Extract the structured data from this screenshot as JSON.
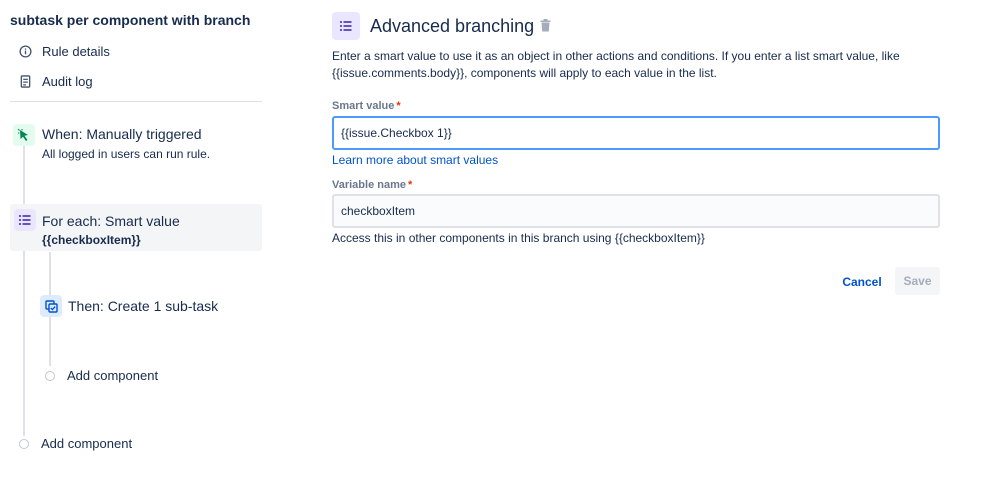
{
  "rule": {
    "title": "subtask per component with branch",
    "nav": [
      {
        "label": "Rule details",
        "icon": "info-icon"
      },
      {
        "label": "Audit log",
        "icon": "document-icon"
      }
    ]
  },
  "flow": {
    "trigger": {
      "title": "When: Manually triggered",
      "subtitle": "All logged in users can run rule.",
      "icon": "cursor-click-icon",
      "color": "#00875a"
    },
    "branch": {
      "title": "For each: Smart value",
      "subtitle": "{{checkboxItem}}",
      "icon": "list-icon",
      "color": "#6554c0"
    },
    "action": {
      "title": "Then: Create 1 sub-task",
      "icon": "subtask-icon",
      "color": "#0052cc"
    },
    "add_inner": "Add component",
    "add_outer": "Add component"
  },
  "config": {
    "title": "Advanced branching",
    "description": "Enter a smart value to use it as an object in other actions and conditions. If you enter a list smart value, like {{issue.comments.body}}, components will apply to each value in the list.",
    "smart_value": {
      "label": "Smart value",
      "required_mark": "*",
      "value": "{{issue.Checkbox 1}}"
    },
    "learn_more": "Learn more about smart values",
    "variable_name": {
      "label": "Variable name",
      "required_mark": "*",
      "value": "checkboxItem"
    },
    "variable_help": "Access this in other components in this branch using {{checkboxItem}}",
    "cancel_label": "Cancel",
    "save_label": "Save",
    "accent_color": "#4c9aff",
    "link_color": "#0052cc"
  }
}
